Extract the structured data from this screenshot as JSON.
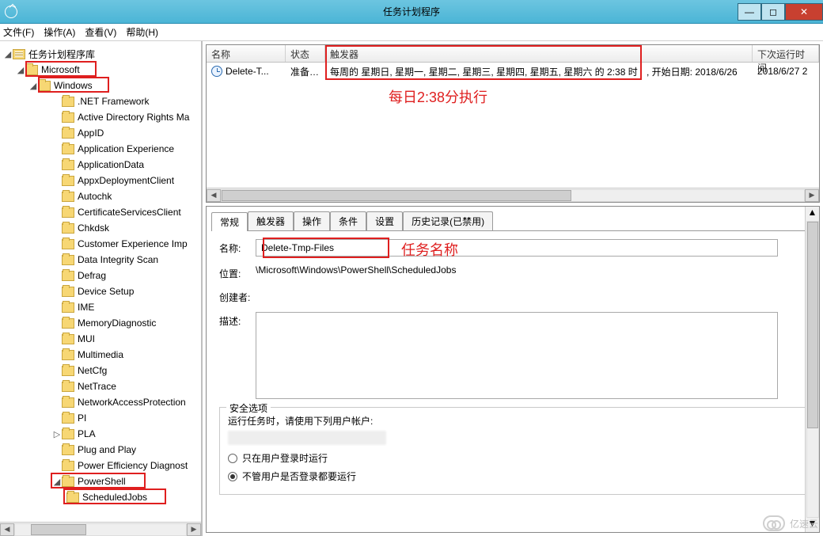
{
  "title": "任务计划程序",
  "menubar": {
    "file": "文件(F)",
    "action": "操作(A)",
    "view": "查看(V)",
    "help": "帮助(H)"
  },
  "tree": {
    "root": "任务计划程序库",
    "microsoft": "Microsoft",
    "windows": "Windows",
    "items": [
      ".NET Framework",
      "Active Directory Rights Ma",
      "AppID",
      "Application Experience",
      "ApplicationData",
      "AppxDeploymentClient",
      "Autochk",
      "CertificateServicesClient",
      "Chkdsk",
      "Customer Experience Imp",
      "Data Integrity Scan",
      "Defrag",
      "Device Setup",
      "IME",
      "MemoryDiagnostic",
      "MUI",
      "Multimedia",
      "NetCfg",
      "NetTrace",
      "NetworkAccessProtection",
      "PI",
      "PLA",
      "Plug and Play",
      "Power Efficiency Diagnost",
      "PowerShell"
    ],
    "scheduledjobs": "ScheduledJobs"
  },
  "tasklist": {
    "cols": {
      "name": "名称",
      "status": "状态",
      "trigger": "触发器",
      "next": "下次运行时间"
    },
    "row": {
      "name": "Delete-T...",
      "status": "准备…",
      "trigger": "每周的 星期日, 星期一, 星期二, 星期三, 星期四, 星期五, 星期六 的 2:38 时",
      "start": ", 开始日期: 2018/6/26",
      "next": "2018/6/27 2"
    },
    "annotation": "每日2:38分执行"
  },
  "detail": {
    "tabs": {
      "general": "常规",
      "triggers": "触发器",
      "actions": "操作",
      "conditions": "条件",
      "settings": "设置",
      "history": "历史记录(已禁用)"
    },
    "labels": {
      "name": "名称:",
      "location": "位置:",
      "author": "创建者:",
      "desc": "描述:"
    },
    "name_value": "Delete-Tmp-Files",
    "location_value": "\\Microsoft\\Windows\\PowerShell\\ScheduledJobs",
    "annotation": "任务名称",
    "security": {
      "legend": "安全选项",
      "runas_label": "运行任务时，请使用下列用户帐户:",
      "opt1": "只在用户登录时运行",
      "opt2": "不管用户是否登录都要运行"
    }
  },
  "watermark": "亿速云"
}
